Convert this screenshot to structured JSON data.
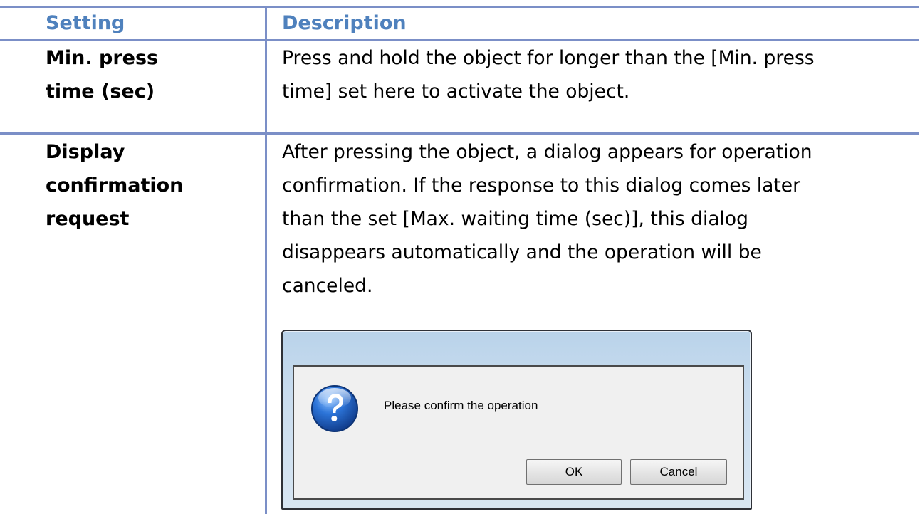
{
  "table": {
    "header": {
      "setting": "Setting",
      "description": "Description"
    },
    "rows": [
      {
        "setting_lines": [
          "Min. press",
          "time (sec)"
        ],
        "description_lines": [
          "Press and hold the object for longer than the [Min. press",
          "time] set here to activate the object."
        ]
      },
      {
        "setting_lines": [
          "Display",
          "confirmation",
          "request"
        ],
        "description_lines": [
          "After pressing the object, a dialog appears for operation",
          "confirmation. If the response to this dialog comes later",
          "than the set [Max. waiting time (sec)], this dialog",
          "disappears automatically and the operation will be",
          "canceled."
        ]
      }
    ]
  },
  "dialog": {
    "icon": "question-icon",
    "message": "Please confirm the operation",
    "ok_label": "OK",
    "cancel_label": "Cancel"
  },
  "colors": {
    "header_text": "#4f81bd",
    "border": "#7b8fc7"
  }
}
